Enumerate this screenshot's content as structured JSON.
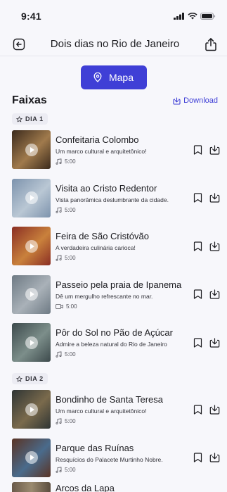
{
  "status": {
    "time": "9:41"
  },
  "nav": {
    "title": "Dois dias no Rio de Janeiro",
    "back_icon": "back-arrow-icon",
    "share_icon": "share-icon"
  },
  "map_button": {
    "label": "Mapa",
    "icon": "map-pin-icon"
  },
  "section": {
    "title": "Faixas",
    "download_label": "Download"
  },
  "days": [
    {
      "label": "DIA 1",
      "tracks": [
        {
          "title": "Confeitaria Colombo",
          "subtitle": "Um marco cultural e arquitetônico!",
          "duration": "5:00",
          "media": "audio",
          "colors": [
            "#3b2a1c",
            "#a07a4c"
          ]
        },
        {
          "title": "Visita ao Cristo Redentor",
          "subtitle": "Vista panorâmica deslumbrante da cidade.",
          "duration": "5:00",
          "media": "audio",
          "colors": [
            "#7d93ad",
            "#b9c7d4"
          ]
        },
        {
          "title": "Feira de São Cristóvão",
          "subtitle": "A verdadeira culinária carioca!",
          "duration": "5:00",
          "media": "audio",
          "colors": [
            "#8a2e24",
            "#c9813c"
          ]
        },
        {
          "title": "Passeio pela praia de Ipanema",
          "subtitle": "Dê um mergulho refrescante no mar.",
          "duration": "5:00",
          "media": "video",
          "colors": [
            "#6e7a84",
            "#a9b1b8"
          ]
        },
        {
          "title": "Pôr do Sol no Pão de Açúcar",
          "subtitle": "Admire a beleza natural do Rio de Janeiro",
          "duration": "5:00",
          "media": "audio",
          "colors": [
            "#3d4a4c",
            "#7c8e8a"
          ]
        }
      ]
    },
    {
      "label": "DIA 2",
      "tracks": [
        {
          "title": "Bondinho de Santa Teresa",
          "subtitle": "Um marco cultural e arquitetônico!",
          "duration": "5:00",
          "media": "audio",
          "colors": [
            "#2e3434",
            "#7a6a4c"
          ]
        },
        {
          "title": "Parque das Ruínas",
          "subtitle": "Resquícios do Palacete Murtinho Nobre.",
          "duration": "5:00",
          "media": "audio",
          "colors": [
            "#5a3324",
            "#4a6b8c"
          ]
        }
      ]
    }
  ],
  "partial_track": {
    "title": "Arcos da Lapa"
  }
}
